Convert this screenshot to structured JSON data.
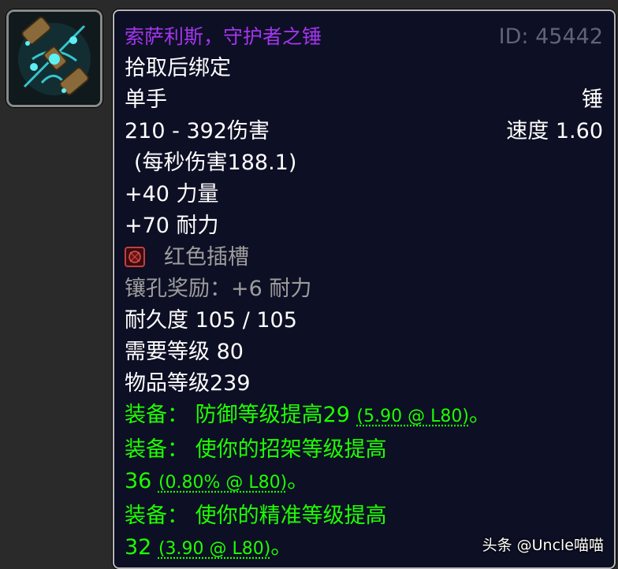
{
  "item": {
    "name": "索萨利斯，守护者之锤",
    "id_label": "ID: 45442",
    "binding": "拾取后绑定",
    "slot": "单手",
    "type": "锤",
    "damage": "210 - 392伤害",
    "speed": "速度 1.60",
    "dps": "(每秒伤害188.1)",
    "stat_strength": "+40 力量",
    "stat_stamina": "+70 耐力",
    "socket_label": "红色插槽",
    "socket_bonus": "镶孔奖励：+6 耐力",
    "durability": "耐久度 105 / 105",
    "required_level": "需要等级 80",
    "item_level": "物品等级239",
    "equip_effects": [
      {
        "prefix": "装备：",
        "text": "防御等级提高29",
        "note": "(5.90 @ L80)",
        "end": "。"
      },
      {
        "prefix": "装备：",
        "text": "使你的招架等级提高",
        "value": "36",
        "note": "(0.80% @ L80)",
        "end": "。"
      },
      {
        "prefix": "装备：",
        "text": "使你的精准等级提高",
        "value": "32",
        "note": "(3.90 @ L80)",
        "end": "。"
      }
    ]
  },
  "watermark": "头条 @Uncle喵喵",
  "icons": {
    "item_icon": "mace-icon",
    "socket_icon": "red-socket-icon"
  },
  "colors": {
    "epic": "#a335ee",
    "green": "#1eff00",
    "gray": "#9d9d9d",
    "tooltip_bg": "#0d0f24"
  }
}
